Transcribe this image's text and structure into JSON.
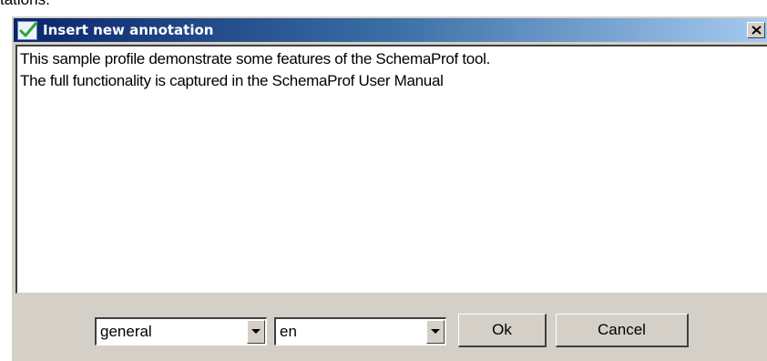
{
  "background": {
    "partial_text": "tations."
  },
  "dialog": {
    "title": "Insert new annotation",
    "title_icon": "checkmark-icon",
    "close_icon": "close-icon",
    "annotation_lines": [
      "This sample profile demonstrate some features of the SchemaProf tool.",
      "The full functionality is captured in the SchemaProf User Manual"
    ],
    "category_select": {
      "value": "general"
    },
    "language_select": {
      "value": "en"
    },
    "ok_label": "Ok",
    "cancel_label": "Cancel",
    "colors": {
      "titlebar_start": "#0a246a",
      "titlebar_end": "#a6caf0",
      "face": "#d4d0c8"
    }
  }
}
